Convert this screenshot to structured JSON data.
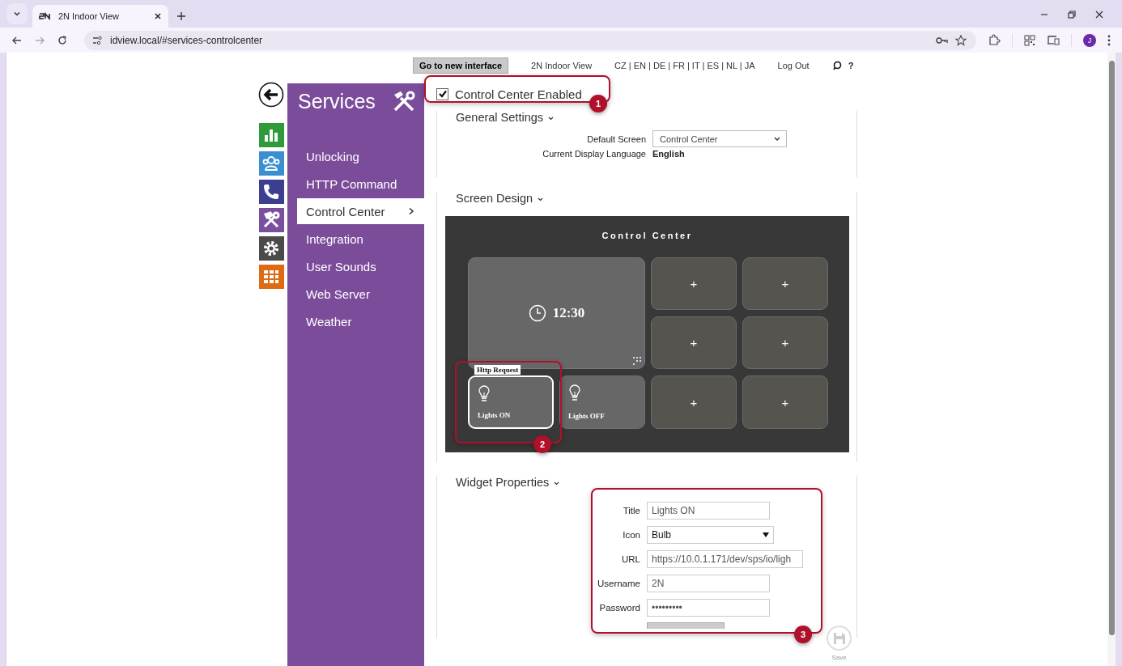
{
  "browser": {
    "tabs": [
      {
        "title": "2N Indoor View",
        "selected": true
      }
    ],
    "url": "idview.local/#services-controlcenter",
    "profile_initial": "J"
  },
  "topbar": {
    "new_interface_button": "Go to new interface",
    "product_link": "2N Indoor View",
    "languages": "CZ | EN | DE | FR | IT | ES | NL | JA",
    "logout": "Log Out",
    "help": "?"
  },
  "icon_rail": [
    {
      "kind": "chart",
      "color": "#2e9a3a"
    },
    {
      "kind": "users",
      "color": "#3a8fd0"
    },
    {
      "kind": "phone",
      "color": "#3b3f8f"
    },
    {
      "kind": "tools",
      "color": "#7b4fa0"
    },
    {
      "kind": "gear",
      "color": "#4a4a4a"
    },
    {
      "kind": "grid",
      "color": "#e06a12"
    }
  ],
  "sidebar": {
    "title": "Services",
    "items": [
      {
        "label": "Unlocking",
        "selected": false
      },
      {
        "label": "HTTP Command",
        "selected": false
      },
      {
        "label": "Control Center",
        "selected": true
      },
      {
        "label": "Integration",
        "selected": false
      },
      {
        "label": "User Sounds",
        "selected": false
      },
      {
        "label": "Web Server",
        "selected": false
      },
      {
        "label": "Weather",
        "selected": false
      }
    ]
  },
  "control_center_enabled": {
    "label": "Control Center Enabled",
    "checked": true
  },
  "general_settings": {
    "title": "General Settings",
    "default_screen_label": "Default Screen",
    "default_screen": "Control Center",
    "language_label": "Current Display Language",
    "language": "English"
  },
  "screen_design": {
    "title": "Screen Design",
    "preview_title": "Control Center",
    "clock": "12:30",
    "widgets": [
      {
        "title": "Lights ON",
        "tag": "Http Request",
        "selected": true
      },
      {
        "title": "Lights OFF",
        "selected": false
      }
    ],
    "empty_slots": [
      "+",
      "+",
      "+",
      "+",
      "+",
      "+"
    ]
  },
  "widget_properties": {
    "title": "Widget Properties",
    "fields": [
      {
        "label": "Title",
        "kind": "text",
        "value": "Lights ON"
      },
      {
        "label": "Icon",
        "kind": "select",
        "value": "Bulb"
      },
      {
        "label": "URL",
        "kind": "url",
        "value": "https://10.0.1.171/dev/sps/io/ligh"
      },
      {
        "label": "Username",
        "kind": "text",
        "value": "2N"
      },
      {
        "label": "Password",
        "kind": "text",
        "value": "•••••••••"
      }
    ]
  },
  "save": {
    "label": "Save"
  },
  "annotations": [
    "1",
    "2",
    "3"
  ]
}
